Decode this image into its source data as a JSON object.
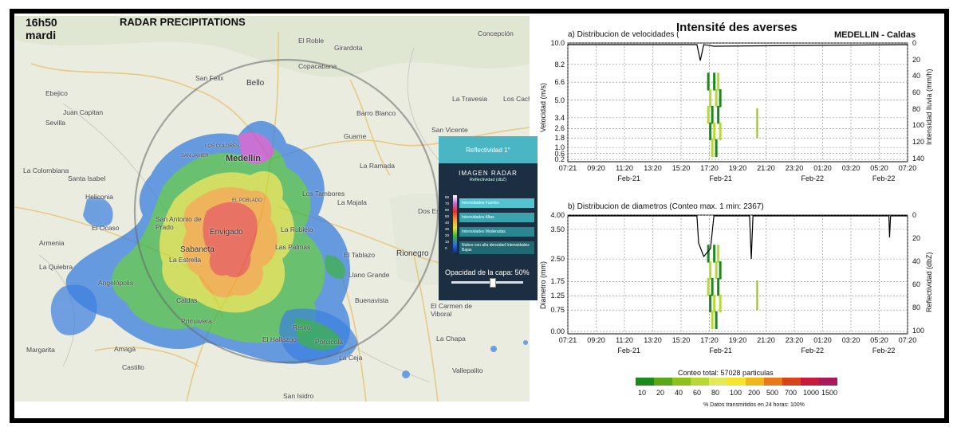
{
  "radar": {
    "time": "16h50",
    "day": "mardi",
    "title": "RADAR PRECIPITATIONS",
    "places": [
      {
        "name": "El Roble",
        "cls": ""
      },
      {
        "name": "Concepción",
        "cls": ""
      },
      {
        "name": "Girardota",
        "cls": ""
      },
      {
        "name": "Copacabana",
        "cls": ""
      },
      {
        "name": "San Felix",
        "cls": ""
      },
      {
        "name": "Bello",
        "cls": "mid"
      },
      {
        "name": "Ebejico",
        "cls": ""
      },
      {
        "name": "Juan Capitan",
        "cls": ""
      },
      {
        "name": "Sevilla",
        "cls": ""
      },
      {
        "name": "La Travesia",
        "cls": ""
      },
      {
        "name": "Los Cach",
        "cls": ""
      },
      {
        "name": "Barro Blanco",
        "cls": ""
      },
      {
        "name": "San Vicente",
        "cls": ""
      },
      {
        "name": "Guarne",
        "cls": ""
      },
      {
        "name": "LOS COLORES",
        "cls": ""
      },
      {
        "name": "SAN JAVIER",
        "cls": ""
      },
      {
        "name": "Medellín",
        "cls": "big"
      },
      {
        "name": "La Ramada",
        "cls": ""
      },
      {
        "name": "La Colombiana",
        "cls": ""
      },
      {
        "name": "Santa Isabel",
        "cls": ""
      },
      {
        "name": "Heliconia",
        "cls": ""
      },
      {
        "name": "Los Tambores",
        "cls": ""
      },
      {
        "name": "La Majala",
        "cls": ""
      },
      {
        "name": "EL POBLADO",
        "cls": ""
      },
      {
        "name": "San Antonio de Prado",
        "cls": ""
      },
      {
        "name": "Dos Ent",
        "cls": ""
      },
      {
        "name": "El Ocaso",
        "cls": ""
      },
      {
        "name": "Envigado",
        "cls": "mid"
      },
      {
        "name": "La Rubiela",
        "cls": ""
      },
      {
        "name": "Armenia",
        "cls": ""
      },
      {
        "name": "Sabaneta",
        "cls": "mid"
      },
      {
        "name": "Las Palmas",
        "cls": ""
      },
      {
        "name": "El Tablazo",
        "cls": ""
      },
      {
        "name": "Rionegro",
        "cls": "mid"
      },
      {
        "name": "La Estrella",
        "cls": ""
      },
      {
        "name": "La Quiebra",
        "cls": ""
      },
      {
        "name": "Angelópolis",
        "cls": ""
      },
      {
        "name": "Llano Grande",
        "cls": ""
      },
      {
        "name": "Caldas",
        "cls": ""
      },
      {
        "name": "Buenavista",
        "cls": ""
      },
      {
        "name": "El Carmen de Viboral",
        "cls": ""
      },
      {
        "name": "Primavera",
        "cls": ""
      },
      {
        "name": "Retiro",
        "cls": ""
      },
      {
        "name": "Margarita",
        "cls": ""
      },
      {
        "name": "Amagá",
        "cls": ""
      },
      {
        "name": "El Hallazgo",
        "cls": ""
      },
      {
        "name": "Porcicola",
        "cls": ""
      },
      {
        "name": "La Chapa",
        "cls": ""
      },
      {
        "name": "Castillo",
        "cls": ""
      },
      {
        "name": "La Ceja",
        "cls": ""
      },
      {
        "name": "Vallepalito",
        "cls": ""
      },
      {
        "name": "San Isidro",
        "cls": ""
      }
    ],
    "roads": [
      "62",
      "60",
      "60",
      "60",
      "60",
      "56",
      "56",
      "60",
      "25"
    ]
  },
  "legend": {
    "header": "Reflectividad 1°",
    "title": "IMAGEN RADAR",
    "subtitle": "Reflectividad (dbZ)",
    "scale": [
      "80",
      "70",
      "60",
      "50",
      "40",
      "30",
      "20",
      "10",
      "0"
    ],
    "items": [
      {
        "label": "Intensidades Fuertes",
        "color": "#53c3cf"
      },
      {
        "label": "Intensidades Altas",
        "color": "#3aa3ae"
      },
      {
        "label": "Intensidades Moderadas",
        "color": "#2a8791"
      },
      {
        "label": "Nubes con alta densidad Intensidades Bajas",
        "color": "#1f6972"
      }
    ],
    "opacity_label": "Opacidad de la capa: 50%",
    "opacity_value": 0.5
  },
  "header": {
    "title": "Intensité des averses",
    "city": "MEDELLIN - Caldas"
  },
  "chart_data": [
    {
      "type": "heatmap",
      "title": "a) Distribucion de velocidades (",
      "ylabel": "Velocidad (m/s)",
      "y2label": "Intensidad lluvia (mm/h)",
      "yticks": [
        "10.0",
        "8.2",
        "6.6",
        "5.0",
        "3.4",
        "2.6",
        "1.8",
        "1.0",
        "0.6",
        "0.2"
      ],
      "y2ticks": [
        "0",
        "20",
        "40",
        "60",
        "80",
        "100",
        "120",
        "140"
      ],
      "xticks": [
        "07:21",
        "09:20",
        "11:20",
        "13:20",
        "15:20",
        "17:20",
        "19:20",
        "21:20",
        "23:20",
        "01:20",
        "03:20",
        "05:20",
        "07:20"
      ],
      "xdates": [
        "Feb-21",
        "Feb-21",
        "Feb-22",
        "Feb-22"
      ]
    },
    {
      "type": "heatmap",
      "title": "b) Distribucion de diametros (Conteo max. 1 min: 2367)",
      "ylabel": "Diametro (mm)",
      "y2label": "Reflectividad (dbZ)",
      "yticks": [
        "4.00",
        "3.50",
        "2.50",
        "1.75",
        "1.25",
        "0.75",
        "0.00"
      ],
      "y2ticks": [
        "0",
        "20",
        "40",
        "60",
        "80",
        "100"
      ],
      "xticks": [
        "07:21",
        "09:20",
        "11:20",
        "13:20",
        "15:20",
        "17:20",
        "19:20",
        "21:20",
        "23:20",
        "01:20",
        "03:20",
        "05:20",
        "07:20"
      ],
      "xdates": [
        "Feb-21",
        "Feb-21",
        "Feb-22",
        "Feb-22"
      ]
    }
  ],
  "colorbar": {
    "title": "Conteo total: 57028 particulas",
    "levels": [
      "10",
      "20",
      "40",
      "60",
      "80",
      "100",
      "200",
      "500",
      "700",
      "1000",
      "1500"
    ],
    "colors": [
      "#1a8a1a",
      "#5aa81a",
      "#8ec21a",
      "#b8d836",
      "#e3ea5a",
      "#f4e42c",
      "#f2b61a",
      "#e77a1a",
      "#d8441a",
      "#c81a3a",
      "#a81a5a"
    ],
    "footer": "% Datos transmitidos en 24 horas: 100%"
  }
}
